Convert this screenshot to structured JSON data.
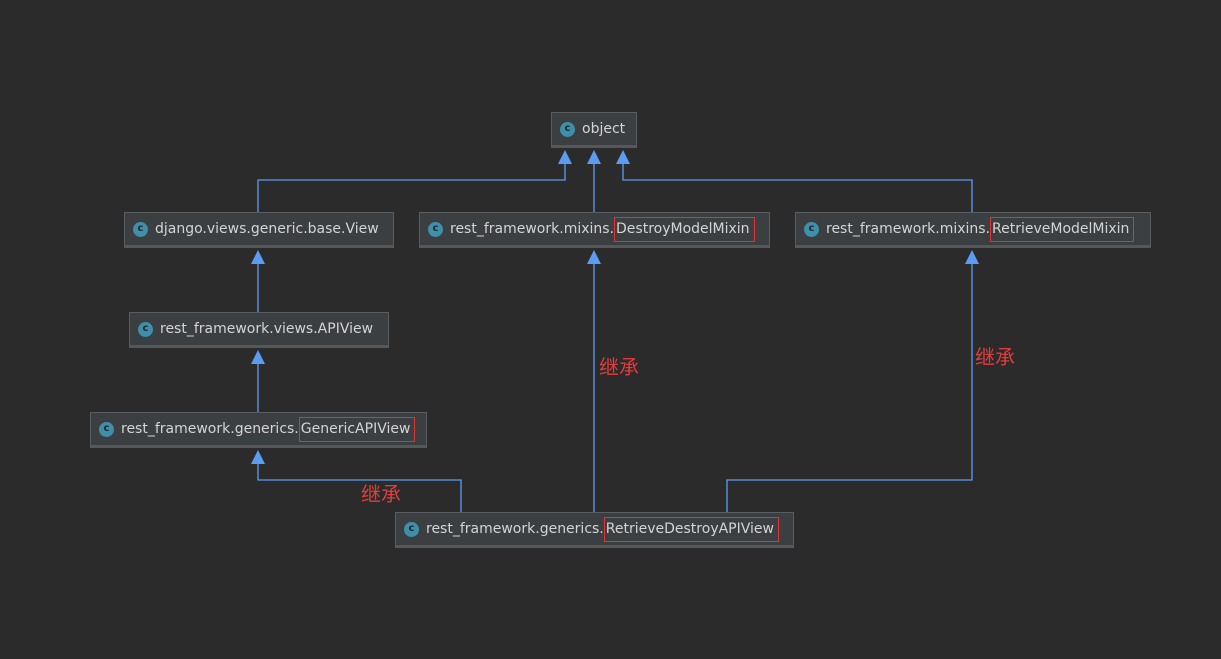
{
  "nodes": {
    "object": {
      "icon": "class-icon",
      "icon_letter": "c",
      "label": "object"
    },
    "view": {
      "icon": "class-icon",
      "icon_letter": "c",
      "label": "django.views.generic.base.View"
    },
    "destroy_mixin": {
      "icon": "class-icon",
      "icon_letter": "c",
      "prefix": "rest_framework.mixins.",
      "name": "DestroyModelMixin"
    },
    "retrieve_mixin": {
      "icon": "class-icon",
      "icon_letter": "c",
      "prefix": "rest_framework.mixins.",
      "name": "RetrieveModelMixin"
    },
    "apiview": {
      "icon": "class-icon",
      "icon_letter": "c",
      "label": "rest_framework.views.APIView"
    },
    "generic_apiview": {
      "icon": "class-icon",
      "icon_letter": "c",
      "prefix": "rest_framework.generics.",
      "name": "GenericAPIView"
    },
    "retrieve_destroy": {
      "icon": "class-icon",
      "icon_letter": "c",
      "prefix": "rest_framework.generics.",
      "name": "RetrieveDestroyAPIView"
    }
  },
  "annotations": {
    "inherit_left": "继承",
    "inherit_middle": "继承",
    "inherit_right": "继承"
  },
  "colors": {
    "background": "#2b2b2b",
    "node_fill": "#3c3f41",
    "edge": "#5b9bf0",
    "highlight": "#e03333",
    "annotation": "#e23c3c",
    "icon": "#3f8fa8"
  }
}
